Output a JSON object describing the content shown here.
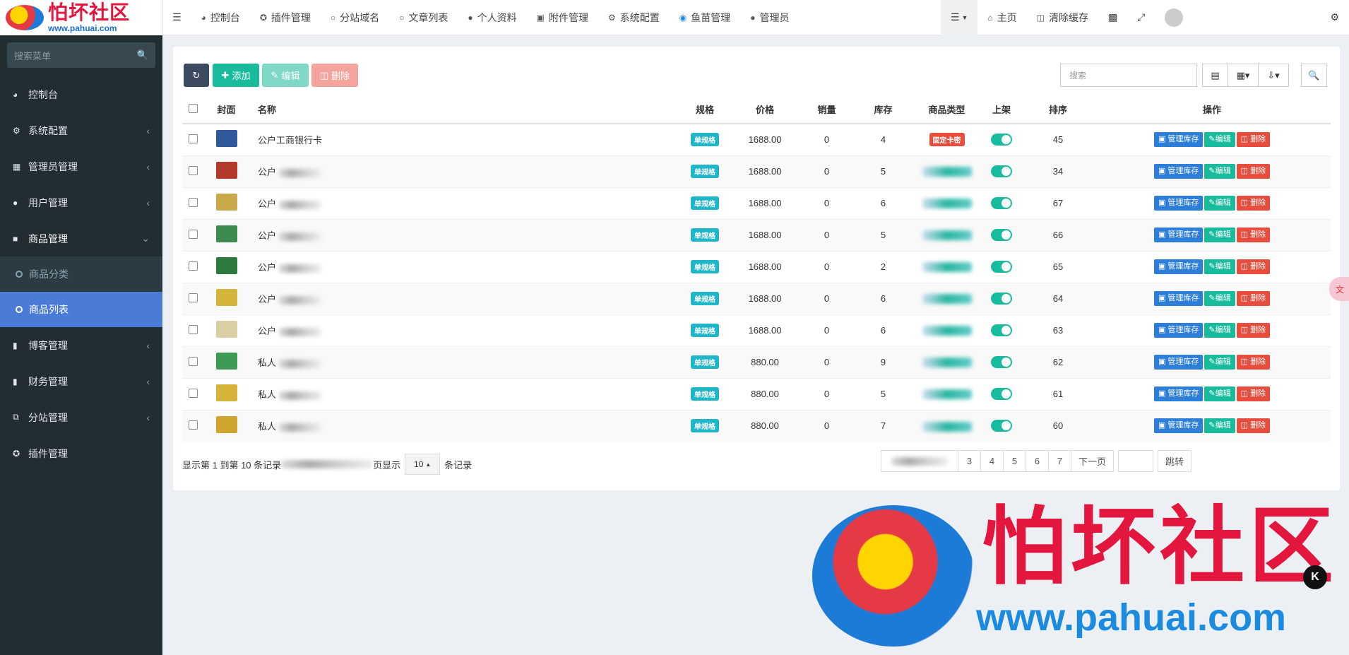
{
  "logo": {
    "cn": "怕坏社区",
    "url": "www.pahuai.com"
  },
  "sidebar": {
    "search_placeholder": "搜索菜单",
    "items": [
      {
        "label": "控制台",
        "icon": "dashboard-icon"
      },
      {
        "label": "系统配置",
        "icon": "cogs-icon"
      },
      {
        "label": "管理员管理",
        "icon": "windows-icon"
      },
      {
        "label": "用户管理",
        "icon": "user-icon"
      },
      {
        "label": "商品管理",
        "icon": "cart-icon"
      },
      {
        "label": "商品分类",
        "icon": "circle-icon"
      },
      {
        "label": "商品列表",
        "icon": "circle-icon"
      },
      {
        "label": "博客管理",
        "icon": "book-icon"
      },
      {
        "label": "财务管理",
        "icon": "bookmark-icon"
      },
      {
        "label": "分站管理",
        "icon": "clone-icon"
      },
      {
        "label": "插件管理",
        "icon": "plug-icon"
      }
    ]
  },
  "topnav": {
    "items": [
      {
        "label": "控制台",
        "icon": "dashboard-icon"
      },
      {
        "label": "插件管理",
        "icon": "plug-icon"
      },
      {
        "label": "分站域名",
        "icon": "circle-icon"
      },
      {
        "label": "文章列表",
        "icon": "circle-icon"
      },
      {
        "label": "个人资料",
        "icon": "user-icon"
      },
      {
        "label": "附件管理",
        "icon": "image-icon"
      },
      {
        "label": "系统配置",
        "icon": "gear-icon"
      },
      {
        "label": "鱼苗管理",
        "icon": "fish-icon"
      },
      {
        "label": "管理员",
        "icon": "user-icon"
      }
    ],
    "home": "主页",
    "clear_cache": "清除缓存"
  },
  "toolbar": {
    "add": "添加",
    "edit": "编辑",
    "delete": "删除",
    "search_placeholder": "搜索"
  },
  "table": {
    "columns": [
      "封面",
      "名称",
      "规格",
      "价格",
      "销量",
      "库存",
      "商品类型",
      "上架",
      "排序",
      "操作"
    ],
    "rows": [
      {
        "name": "公户工商银行卡",
        "spec": "单规格",
        "price": "1688.00",
        "sales": "0",
        "stock": "4",
        "type": "固定卡密",
        "sort": "45",
        "thumb": "#2f5b9c"
      },
      {
        "name": "公户",
        "spec": "单规格",
        "price": "1688.00",
        "sales": "0",
        "stock": "5",
        "type": "",
        "sort": "34",
        "thumb": "#b33a2a"
      },
      {
        "name": "公户",
        "spec": "单规格",
        "price": "1688.00",
        "sales": "0",
        "stock": "6",
        "type": "",
        "sort": "67",
        "thumb": "#c9a94a"
      },
      {
        "name": "公户",
        "spec": "单规格",
        "price": "1688.00",
        "sales": "0",
        "stock": "5",
        "type": "",
        "sort": "66",
        "thumb": "#3d8a4e"
      },
      {
        "name": "公户",
        "spec": "单规格",
        "price": "1688.00",
        "sales": "0",
        "stock": "2",
        "type": "",
        "sort": "65",
        "thumb": "#2e7a3c"
      },
      {
        "name": "公户",
        "spec": "单规格",
        "price": "1688.00",
        "sales": "0",
        "stock": "6",
        "type": "",
        "sort": "64",
        "thumb": "#d4b43a"
      },
      {
        "name": "公户",
        "spec": "单规格",
        "price": "1688.00",
        "sales": "0",
        "stock": "6",
        "type": "",
        "sort": "63",
        "thumb": "#d9cfa2"
      },
      {
        "name": "私人",
        "spec": "单规格",
        "price": "880.00",
        "sales": "0",
        "stock": "9",
        "type": "",
        "sort": "62",
        "thumb": "#3f9a55"
      },
      {
        "name": "私人",
        "spec": "单规格",
        "price": "880.00",
        "sales": "0",
        "stock": "5",
        "type": "",
        "sort": "61",
        "thumb": "#d6b43c"
      },
      {
        "name": "私人",
        "spec": "单规格",
        "price": "880.00",
        "sales": "0",
        "stock": "7",
        "type": "",
        "sort": "60",
        "thumb": "#cfa52e"
      }
    ],
    "actions": {
      "stock": "管理库存",
      "edit": "编辑",
      "delete": "删除"
    }
  },
  "footer": {
    "summary": "显示第 1 到第 10 条记录",
    "per_page_suffix": "页显示",
    "page_size": "10",
    "records": "条记录",
    "pages": [
      "3",
      "4",
      "5",
      "6",
      "7"
    ],
    "next": "下一页",
    "jump": "跳转"
  },
  "watermark": {
    "cn": "怕坏社区",
    "url": "www.pahuai.com"
  },
  "colors": {
    "primary": "#18bc9c",
    "danger": "#e74c3c",
    "info": "#2c7ed8",
    "sidebar": "#222d32",
    "active": "#4a7bd6"
  }
}
